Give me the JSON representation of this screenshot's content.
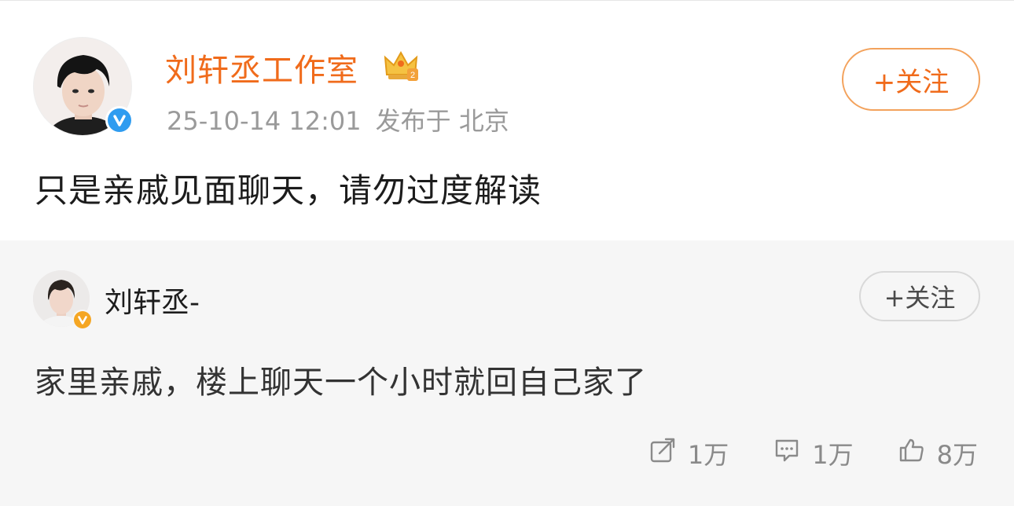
{
  "post": {
    "author": "刘轩丞工作室",
    "timestamp": "25-10-14 12:01",
    "location": "发布于 北京",
    "follow_label": "+关注",
    "text": "只是亲戚见面聊天，请勿过度解读",
    "badge_icon": "crown-icon",
    "verify_icon": "blue-verified-icon"
  },
  "quote": {
    "author": "刘轩丞-",
    "follow_label": "+关注",
    "text": "家里亲戚，楼上聊天一个小时就回自己家了",
    "verify_icon": "orange-verified-icon"
  },
  "stats": {
    "repost": {
      "icon": "repost-icon",
      "count": "1万"
    },
    "comment": {
      "icon": "comment-icon",
      "count": "1万"
    },
    "like": {
      "icon": "thumbs-up-icon",
      "count": "8万"
    }
  },
  "colors": {
    "accent": "#f06b1b",
    "verified_blue": "#2f9cf0",
    "verified_orange": "#f5a623",
    "muted": "#9a9a9a"
  }
}
